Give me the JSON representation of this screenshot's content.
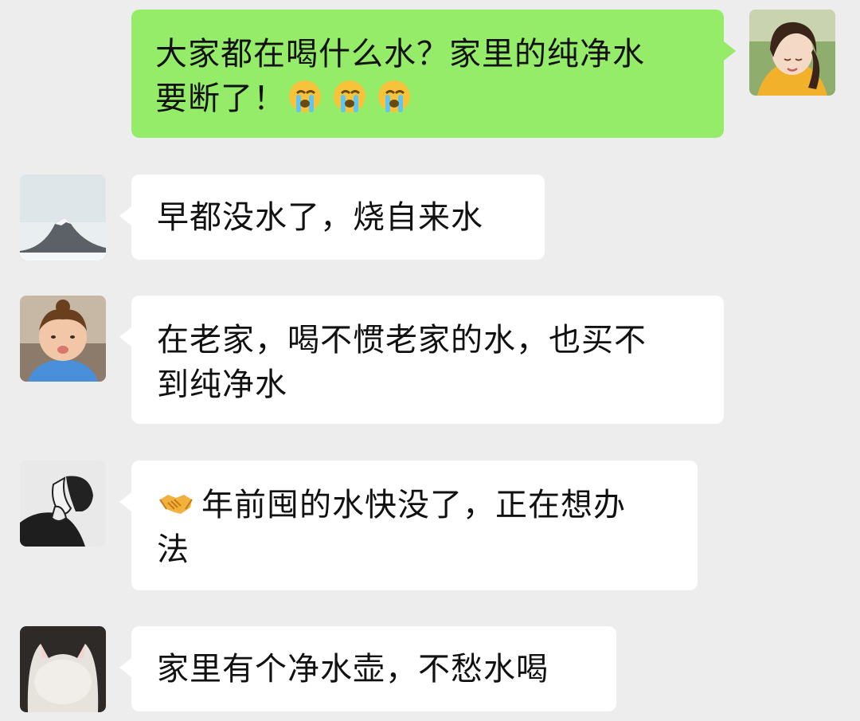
{
  "messages": [
    {
      "sender": "self",
      "text_line1": "大家都在喝什么水？家里的纯净水",
      "text_line2": "要断了！",
      "emoji": "loudly-crying-face",
      "emoji_count": 3
    },
    {
      "sender": "other",
      "text": "早都没水了，烧自来水"
    },
    {
      "sender": "other",
      "text_line1": "在老家，喝不惯老家的水，也买不",
      "text_line2": "到纯净水"
    },
    {
      "sender": "other",
      "emoji": "handshake",
      "text_line1": "年前囤的水快没了，正在想办",
      "text_line2": "法"
    },
    {
      "sender": "other",
      "text": "家里有个净水壶，不愁水喝"
    }
  ],
  "colors": {
    "background": "#ededed",
    "self_bubble": "#95ec69",
    "other_bubble": "#ffffff",
    "text": "#111111"
  }
}
